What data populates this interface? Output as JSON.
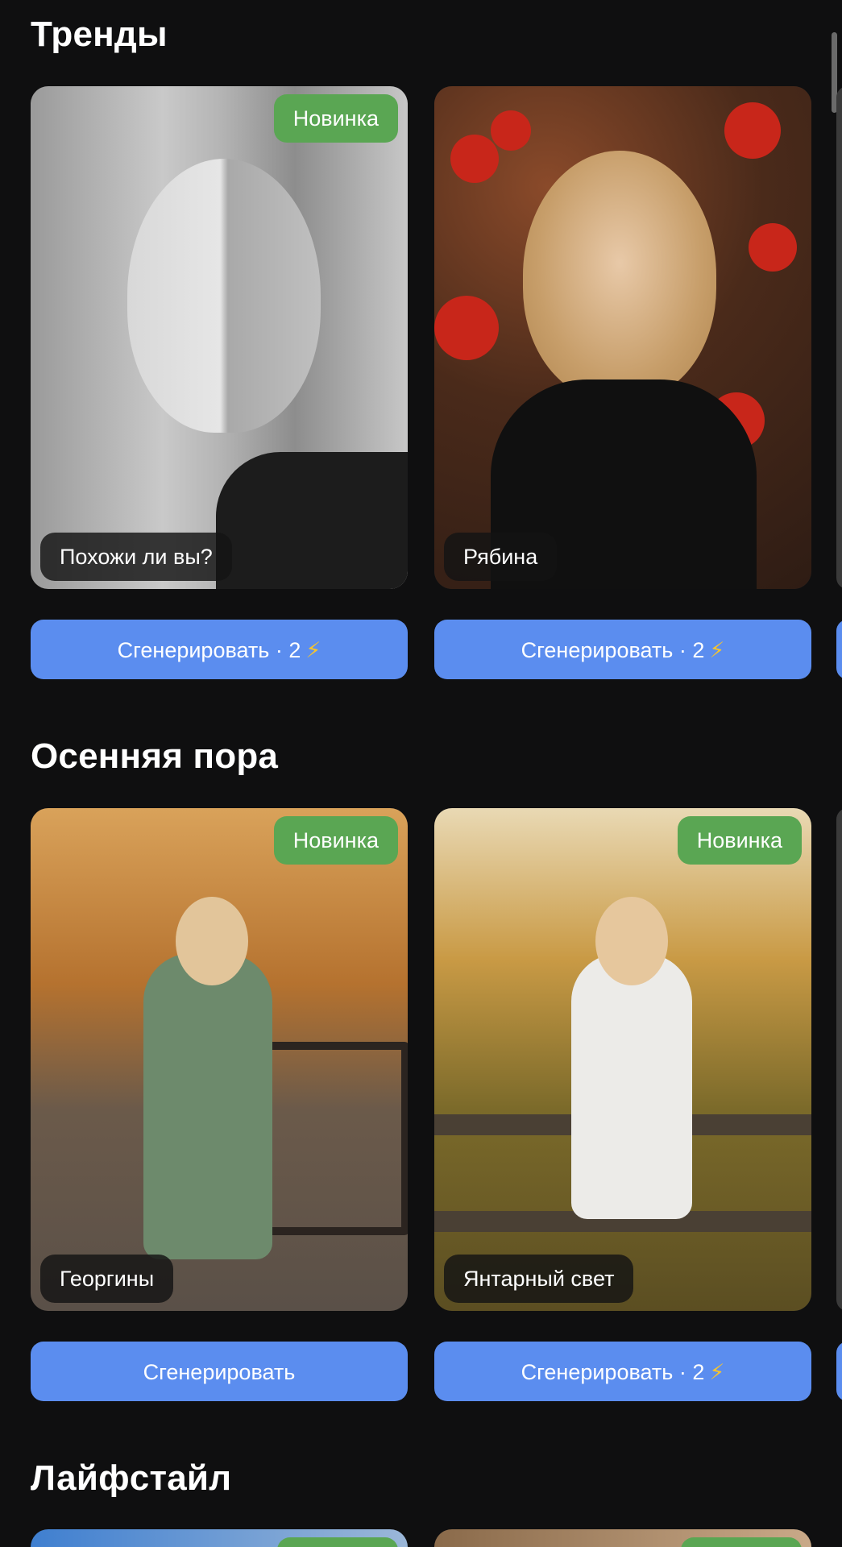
{
  "sections": [
    {
      "title": "Тренды",
      "cards": [
        {
          "label": "Похожи ли вы?",
          "badge": "Новинка",
          "button": "Сгенерировать · 2",
          "bolt": "⚡"
        },
        {
          "label": "Рябина",
          "badge": "",
          "button": "Сгенерировать · 2",
          "bolt": "⚡"
        }
      ]
    },
    {
      "title": "Осенняя пора",
      "cards": [
        {
          "label": "Георгины",
          "badge": "Новинка",
          "button": "Сгенерировать",
          "bolt": ""
        },
        {
          "label": "Янтарный свет",
          "badge": "Новинка",
          "button": "Сгенерировать · 2",
          "bolt": "⚡"
        }
      ]
    },
    {
      "title": "Лайфстайл"
    }
  ],
  "colors": {
    "background": "#0f0f10",
    "button": "#5b8def",
    "badge": "#5aa653",
    "bolt": "#f4c430"
  }
}
